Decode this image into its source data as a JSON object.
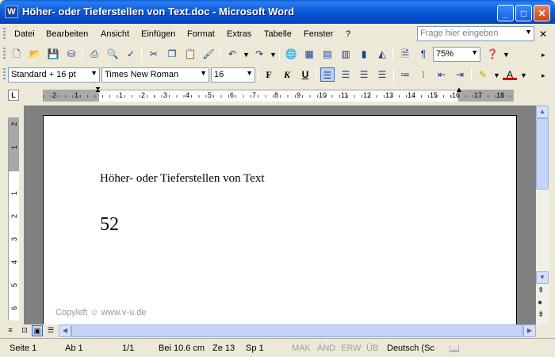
{
  "window": {
    "title": "Höher- oder Tieferstellen von Text.doc - Microsoft Word",
    "app_icon": "W",
    "controls": {
      "minimize": "_",
      "maximize": "□",
      "close": "✕"
    }
  },
  "menu": {
    "items": [
      "Datei",
      "Bearbeiten",
      "Ansicht",
      "Einfügen",
      "Format",
      "Extras",
      "Tabelle",
      "Fenster",
      "?"
    ],
    "ask_placeholder": "Frage hier eingeben"
  },
  "toolbar_standard": {
    "zoom": "75%"
  },
  "toolbar_format": {
    "style": "Standard + 16 pt",
    "font": "Times New Roman",
    "size": "16",
    "bold": "F",
    "italic": "K",
    "underline": "U",
    "alignment": "left"
  },
  "ruler": {
    "labels": [
      "2",
      "1",
      "1",
      "2",
      "3",
      "4",
      "5",
      "6",
      "7",
      "8",
      "9",
      "10",
      "11",
      "12",
      "13",
      "14",
      "15",
      "16",
      "17",
      "18"
    ],
    "vertical_labels": [
      "2",
      "1",
      "1",
      "2",
      "3",
      "4",
      "5",
      "6"
    ]
  },
  "document": {
    "heading": "Höher- oder Tieferstellen von Text",
    "number": "52"
  },
  "watermark": "Copyleft ☺ www.v-u.de",
  "status": {
    "page": "Seite  1",
    "section": "Ab  1",
    "pages": "1/1",
    "position": "Bei  10.6 cm",
    "line": "Ze  13",
    "column": "Sp  1",
    "mak": "MAK",
    "and": "ÄND",
    "erw": "ERW",
    "ub": "ÜB",
    "language": "Deutsch (Sc"
  },
  "colors": {
    "title_bar": "#0a58d6",
    "chrome": "#ece9d8",
    "page_bg": "#808080"
  }
}
